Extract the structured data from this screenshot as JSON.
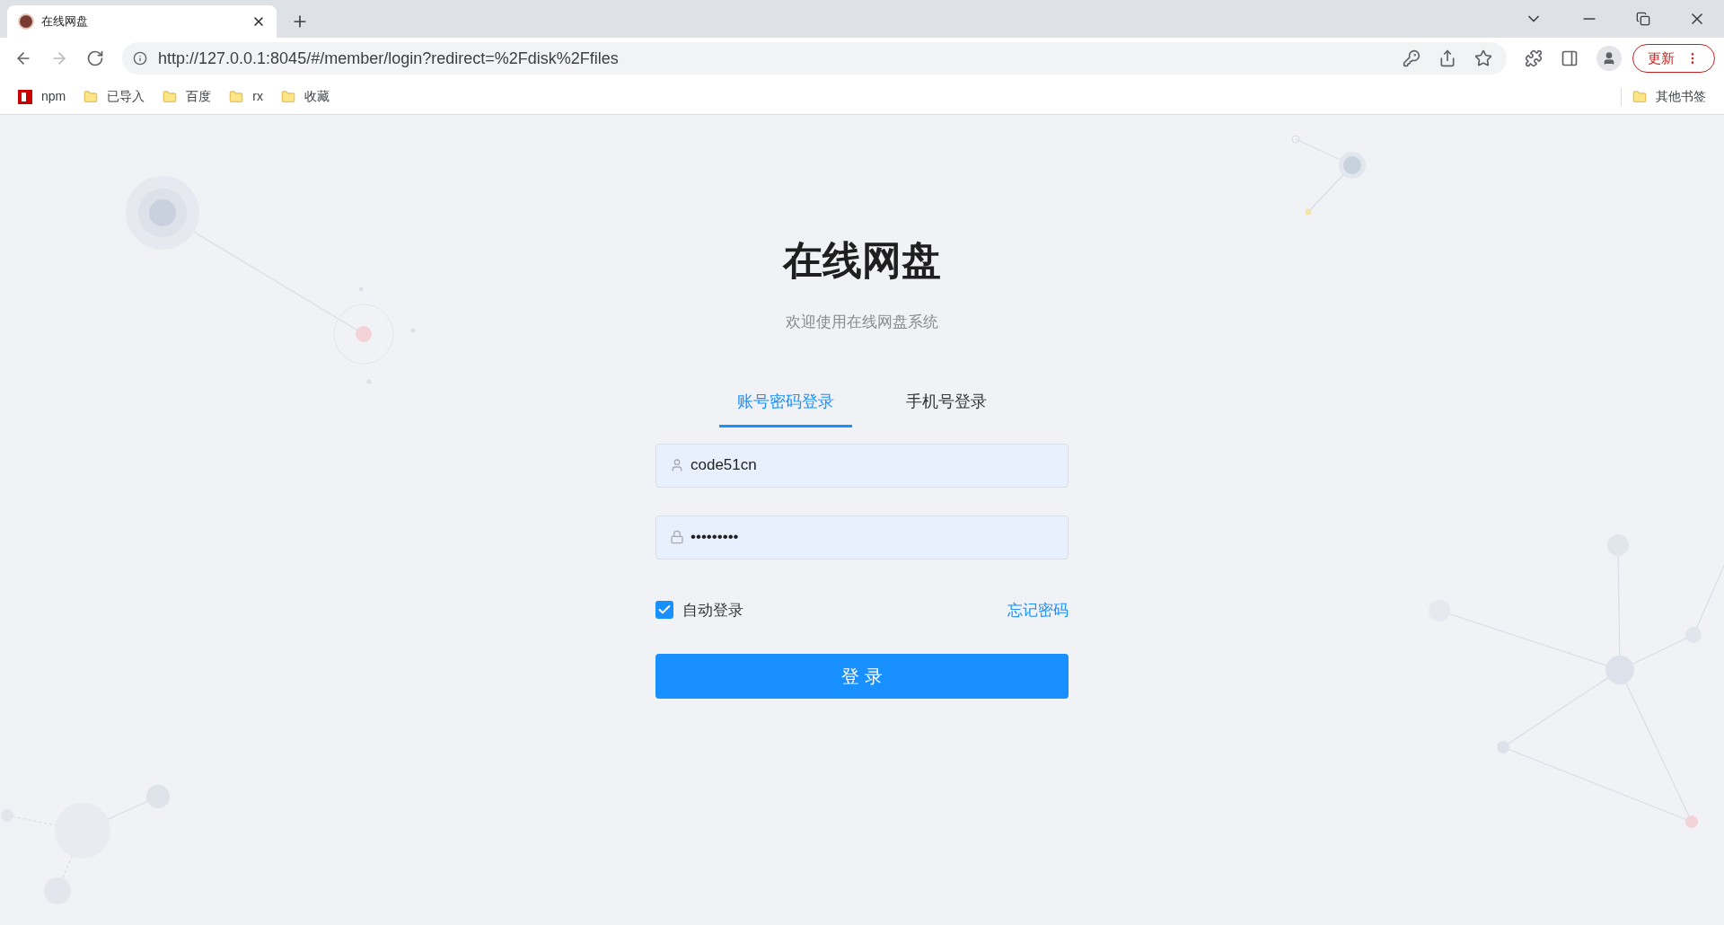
{
  "browser": {
    "tab_title": "在线网盘",
    "url": "http://127.0.0.1:8045/#/member/login?redirect=%2Fdisk%2Ffiles",
    "update_button": "更新",
    "bookmarks": [
      {
        "label": "npm",
        "kind": "npm"
      },
      {
        "label": "已导入",
        "kind": "folder"
      },
      {
        "label": "百度",
        "kind": "folder"
      },
      {
        "label": "rx",
        "kind": "folder"
      },
      {
        "label": "收藏",
        "kind": "folder"
      }
    ],
    "other_bookmarks": "其他书签"
  },
  "page": {
    "title": "在线网盘",
    "subtitle": "欢迎使用在线网盘系统",
    "tabs": [
      {
        "label": "账号密码登录",
        "selected": true
      },
      {
        "label": "手机号登录",
        "selected": false
      }
    ],
    "username": {
      "value": "code51cn"
    },
    "password": {
      "value": "•••••••••"
    },
    "remember": {
      "label": "自动登录",
      "checked": true
    },
    "forgot_link": "忘记密码",
    "login_button": "登 录"
  }
}
